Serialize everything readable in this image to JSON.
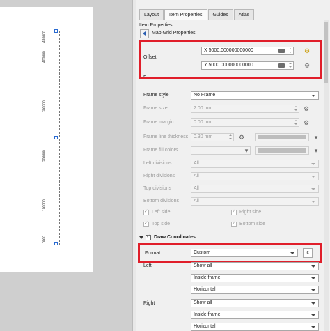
{
  "map": {
    "grid_labels": [
      "410000",
      "400000",
      "300000",
      "200000",
      "100000",
      "0000"
    ]
  },
  "tabs": [
    {
      "label": "Layout",
      "active": false
    },
    {
      "label": "Item Properties",
      "active": true
    },
    {
      "label": "Guides",
      "active": false
    },
    {
      "label": "Atlas",
      "active": false
    }
  ],
  "panel": {
    "title": "Item Properties",
    "back_label": "Map Grid Properties",
    "offset": {
      "label": "Offset",
      "x_value": "X 5000.000000000000",
      "y_value": "Y 5000.000000000000"
    },
    "cut_label": "F",
    "frame_style": {
      "label": "Frame style",
      "value": "No Frame"
    },
    "frame_size": {
      "label": "Frame size",
      "value": "2.00 mm"
    },
    "frame_margin": {
      "label": "Frame margin",
      "value": "0.00 mm"
    },
    "frame_line_thickness": {
      "label": "Frame line thickness",
      "value": "0.30 mm"
    },
    "frame_fill_colors": {
      "label": "Frame fill colors"
    },
    "divisions": [
      {
        "label": "Left divisions",
        "value": "All"
      },
      {
        "label": "Right divisions",
        "value": "All"
      },
      {
        "label": "Top divisions",
        "value": "All"
      },
      {
        "label": "Bottom divisions",
        "value": "All"
      }
    ],
    "sides": {
      "left": "Left side",
      "right": "Right side",
      "top": "Top side",
      "bottom": "Bottom side"
    },
    "draw_coordinates": {
      "label": "Draw Coordinates",
      "format_label": "Format",
      "format_value": "Custom",
      "left_label": "Left",
      "left_values": [
        "Show all",
        "Inside frame",
        "Horizontal"
      ],
      "right_label": "Right",
      "right_values": [
        "Show all",
        "Inside frame",
        "Horizontal"
      ]
    }
  },
  "icons": {
    "dd_icon": "data-defined-override-icon",
    "expr": "expression-icon",
    "ε": "ε"
  },
  "colors": {
    "highlight": "#e01e2a",
    "accent": "#2a5db0"
  }
}
